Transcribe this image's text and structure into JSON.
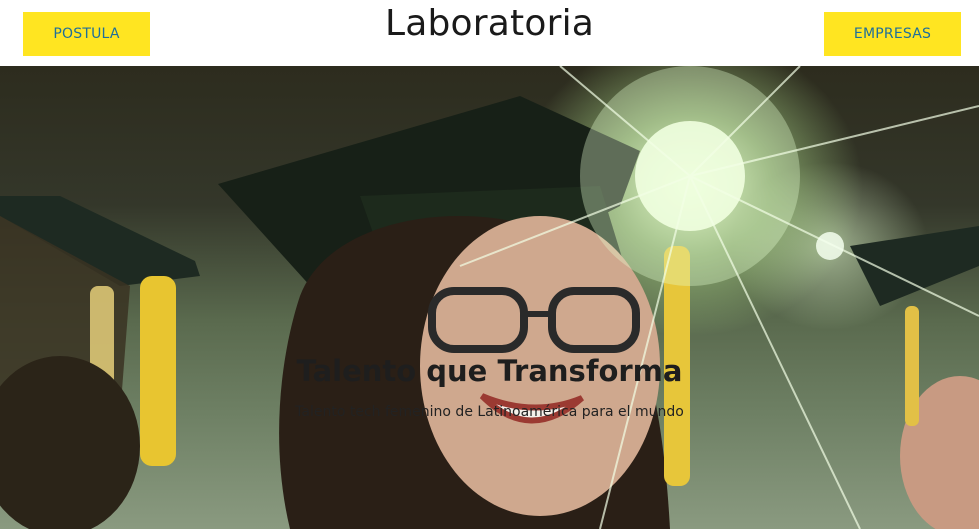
{
  "header": {
    "logo": "Laboratoria",
    "left_button": "POSTULA",
    "right_button": "EMPRESAS"
  },
  "hero": {
    "title": "Talento que Transforma",
    "subtitle": "Talento tech femenino de Latinoamérica para el mundo",
    "image_icon": "graduation-photo"
  },
  "colors": {
    "button_bg": "#ffe521",
    "button_text": "#1f6f9a",
    "logo_text": "#1a1a1a"
  }
}
